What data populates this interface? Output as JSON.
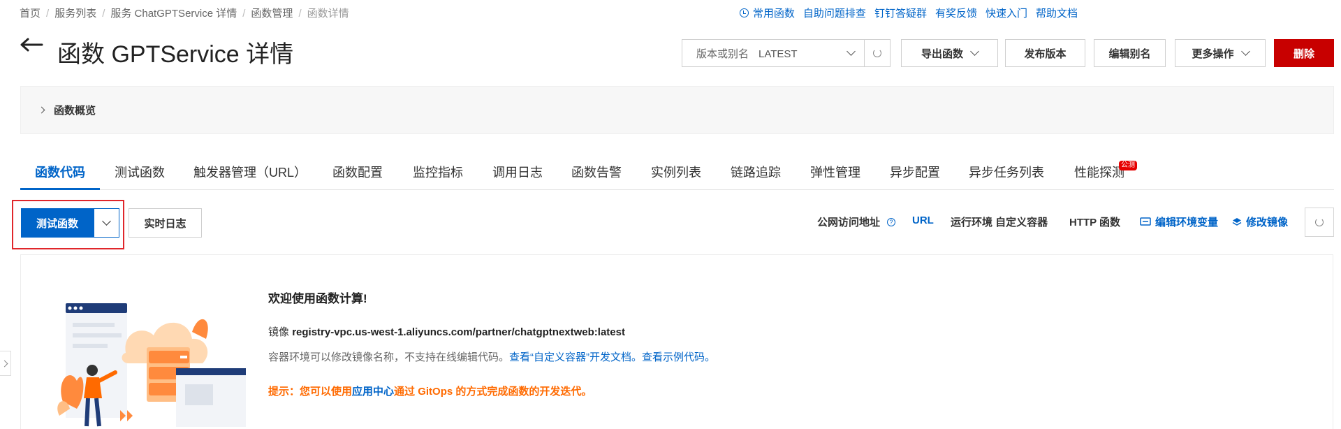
{
  "breadcrumb": [
    "首页",
    "服务列表",
    "服务 ChatGPTService 详情",
    "函数管理",
    "函数详情"
  ],
  "top_links": [
    "常用函数",
    "自助问题排查",
    "钉钉答疑群",
    "有奖反馈",
    "快速入门",
    "帮助文档"
  ],
  "header": {
    "title": "函数 GPTService 详情",
    "version_label": "版本或别名",
    "version_value": "LATEST",
    "export_label": "导出函数",
    "publish_label": "发布版本",
    "edit_alias_label": "编辑别名",
    "more_label": "更多操作",
    "delete_label": "删除"
  },
  "overview": {
    "label": "函数概览"
  },
  "tabs": [
    {
      "label": "函数代码",
      "active": true
    },
    {
      "label": "测试函数"
    },
    {
      "label": "触发器管理（URL）"
    },
    {
      "label": "函数配置"
    },
    {
      "label": "监控指标"
    },
    {
      "label": "调用日志"
    },
    {
      "label": "函数告警"
    },
    {
      "label": "实例列表"
    },
    {
      "label": "链路追踪"
    },
    {
      "label": "弹性管理"
    },
    {
      "label": "异步配置"
    },
    {
      "label": "异步任务列表"
    },
    {
      "label": "性能探测",
      "badge": "公测"
    }
  ],
  "actions": {
    "test_label": "测试函数",
    "realtime_log_label": "实时日志",
    "public_url_label": "公网访问地址",
    "url_label": "URL",
    "runtime_label": "运行环境 自定义容器",
    "http_label": "HTTP 函数",
    "edit_env_label": "编辑环境变量",
    "edit_image_label": "修改镜像"
  },
  "welcome": {
    "title": "欢迎使用函数计算!",
    "image_prefix": "镜像",
    "image_value": "registry-vpc.us-west-1.aliyuncs.com/partner/chatgptnextweb:latest",
    "desc_text": "容器环境可以修改镜像名称，不支持在线编辑代码。",
    "desc_link1": "查看“自定义容器”开发文档。",
    "desc_link2": "查看示例代码。",
    "tip_prefix": "提示：您可以使用",
    "tip_link": "应用中心",
    "tip_suffix": "通过 GitOps 的方式完成函数的开发迭代。"
  },
  "colors": {
    "primary": "#0064c8",
    "danger": "#c80000",
    "tip": "#ff6a00",
    "highlight": "#e0262b"
  },
  "icons": [
    "back-arrow-icon",
    "clock-icon",
    "chevron-down-icon",
    "refresh-icon",
    "chevron-right-icon",
    "help-icon",
    "env-edit-icon",
    "layers-icon"
  ]
}
